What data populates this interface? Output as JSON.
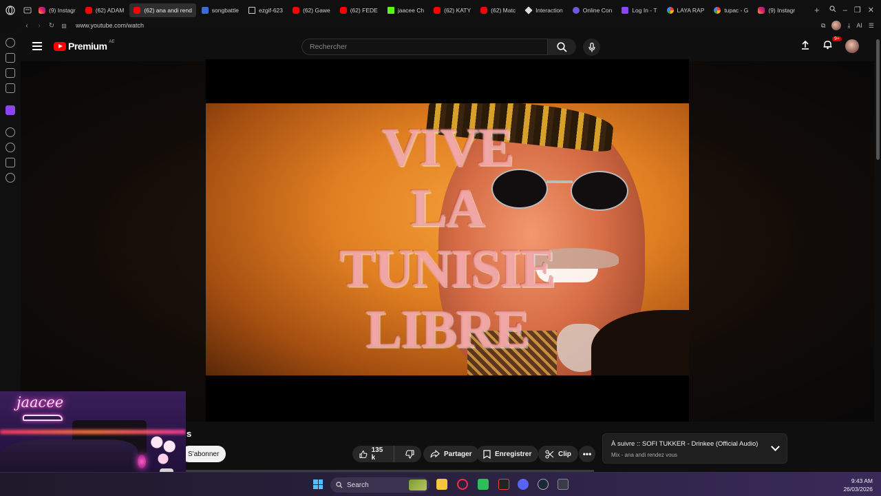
{
  "browser": {
    "tabs": [
      {
        "label": "(9) Instagr",
        "favicon": "instagram-icon"
      },
      {
        "label": "(62) ADAM",
        "favicon": "youtube-icon"
      },
      {
        "label": "(62) ana andi rend",
        "favicon": "youtube-icon",
        "active": true
      },
      {
        "label": "songbattle",
        "favicon": "bluesky-icon"
      },
      {
        "label": "ezgif-623",
        "favicon": "document-icon"
      },
      {
        "label": "(62) Gawe",
        "favicon": "youtube-icon"
      },
      {
        "label": "(62) FEDE",
        "favicon": "youtube-icon"
      },
      {
        "label": "jaacee Ch",
        "favicon": "kick-icon"
      },
      {
        "label": "(62) KATY",
        "favicon": "youtube-icon"
      },
      {
        "label": "(62) Matc",
        "favicon": "youtube-icon"
      },
      {
        "label": "Interaction",
        "favicon": "diamond-icon"
      },
      {
        "label": "Online Con",
        "favicon": "circle-icon"
      },
      {
        "label": "Log In - T",
        "favicon": "twitch-icon"
      },
      {
        "label": "LAYA RAP",
        "favicon": "google-icon"
      },
      {
        "label": "tupac - G",
        "favicon": "google-icon"
      },
      {
        "label": "(9) Instagr",
        "favicon": "instagram-icon"
      }
    ],
    "url": "www.youtube.com/watch",
    "ai_label": "AI"
  },
  "youtube": {
    "brand": "Premium",
    "country": "AE",
    "search_placeholder": "Rechercher",
    "notification_count": "9+",
    "video_overlay_lines": [
      "VIVE",
      "LA",
      "TUNISIE",
      "LIBRE"
    ],
    "title_fragment": "us",
    "subscribe_label": "S'abonner",
    "like_count": "135 k",
    "share_label": "Partager",
    "save_label": "Enregistrer",
    "clip_label": "Clip",
    "up_next": {
      "title": "À suivre :: SOFI TUKKER - Drinkee (Official Audio)",
      "subtitle": "Mix - ana andi rendez vous"
    }
  },
  "webcam": {
    "logo_text": "jaacee"
  },
  "taskbar": {
    "search_label": "Search",
    "time": "9:43 AM",
    "date": "26/03/2026"
  },
  "colors": {
    "youtube_red": "#ff0000",
    "background": "#0f0f0f",
    "neon_pink": "#ff4fd8"
  }
}
